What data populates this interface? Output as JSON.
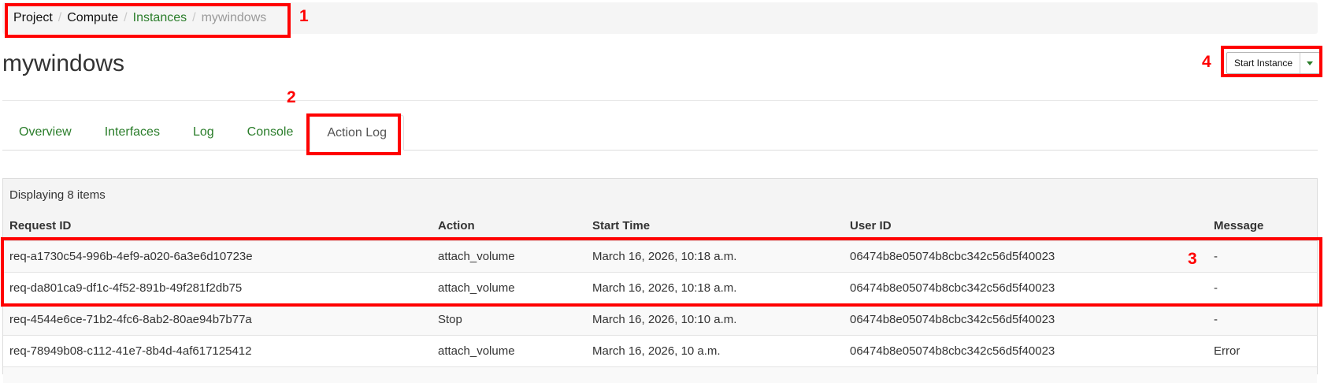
{
  "breadcrumb": {
    "project": "Project",
    "compute": "Compute",
    "instances": "Instances",
    "current": "mywindows",
    "separator": "/"
  },
  "page": {
    "title": "mywindows"
  },
  "actions": {
    "start_instance_label": "Start Instance"
  },
  "tabs": [
    {
      "label": "Overview"
    },
    {
      "label": "Interfaces"
    },
    {
      "label": "Log"
    },
    {
      "label": "Console"
    },
    {
      "label": "Action Log",
      "active": true
    }
  ],
  "table": {
    "caption": "Displaying 8 items",
    "headers": [
      "Request ID",
      "Action",
      "Start Time",
      "User ID",
      "Message"
    ],
    "rows": [
      {
        "request_id": "req-a1730c54-996b-4ef9-a020-6a3e6d10723e",
        "action": "attach_volume",
        "start_time": "March 16, 2026, 10:18 a.m.",
        "user_id": "06474b8e05074b8cbc342c56d5f40023",
        "message": "-"
      },
      {
        "request_id": "req-da801ca9-df1c-4f52-891b-49f281f2db75",
        "action": "attach_volume",
        "start_time": "March 16, 2026, 10:18 a.m.",
        "user_id": "06474b8e05074b8cbc342c56d5f40023",
        "message": "-"
      },
      {
        "request_id": "req-4544e6ce-71b2-4fc6-8ab2-80ae94b7b77a",
        "action": "Stop",
        "start_time": "March 16, 2026, 10:10 a.m.",
        "user_id": "06474b8e05074b8cbc342c56d5f40023",
        "message": "-"
      },
      {
        "request_id": "req-78949b08-c112-41e7-8b4d-4af617125412",
        "action": "attach_volume",
        "start_time": "March 16, 2026, 10 a.m.",
        "user_id": "06474b8e05074b8cbc342c56d5f40023",
        "message": "Error"
      }
    ]
  },
  "annotations": {
    "labels": [
      "1",
      "2",
      "3",
      "4"
    ],
    "color": "#ff0000"
  },
  "colors": {
    "link_green": "#2a7d2a",
    "table_header_bg": "#f4f4f4",
    "row_stripe_bg": "#f9f9f9"
  }
}
